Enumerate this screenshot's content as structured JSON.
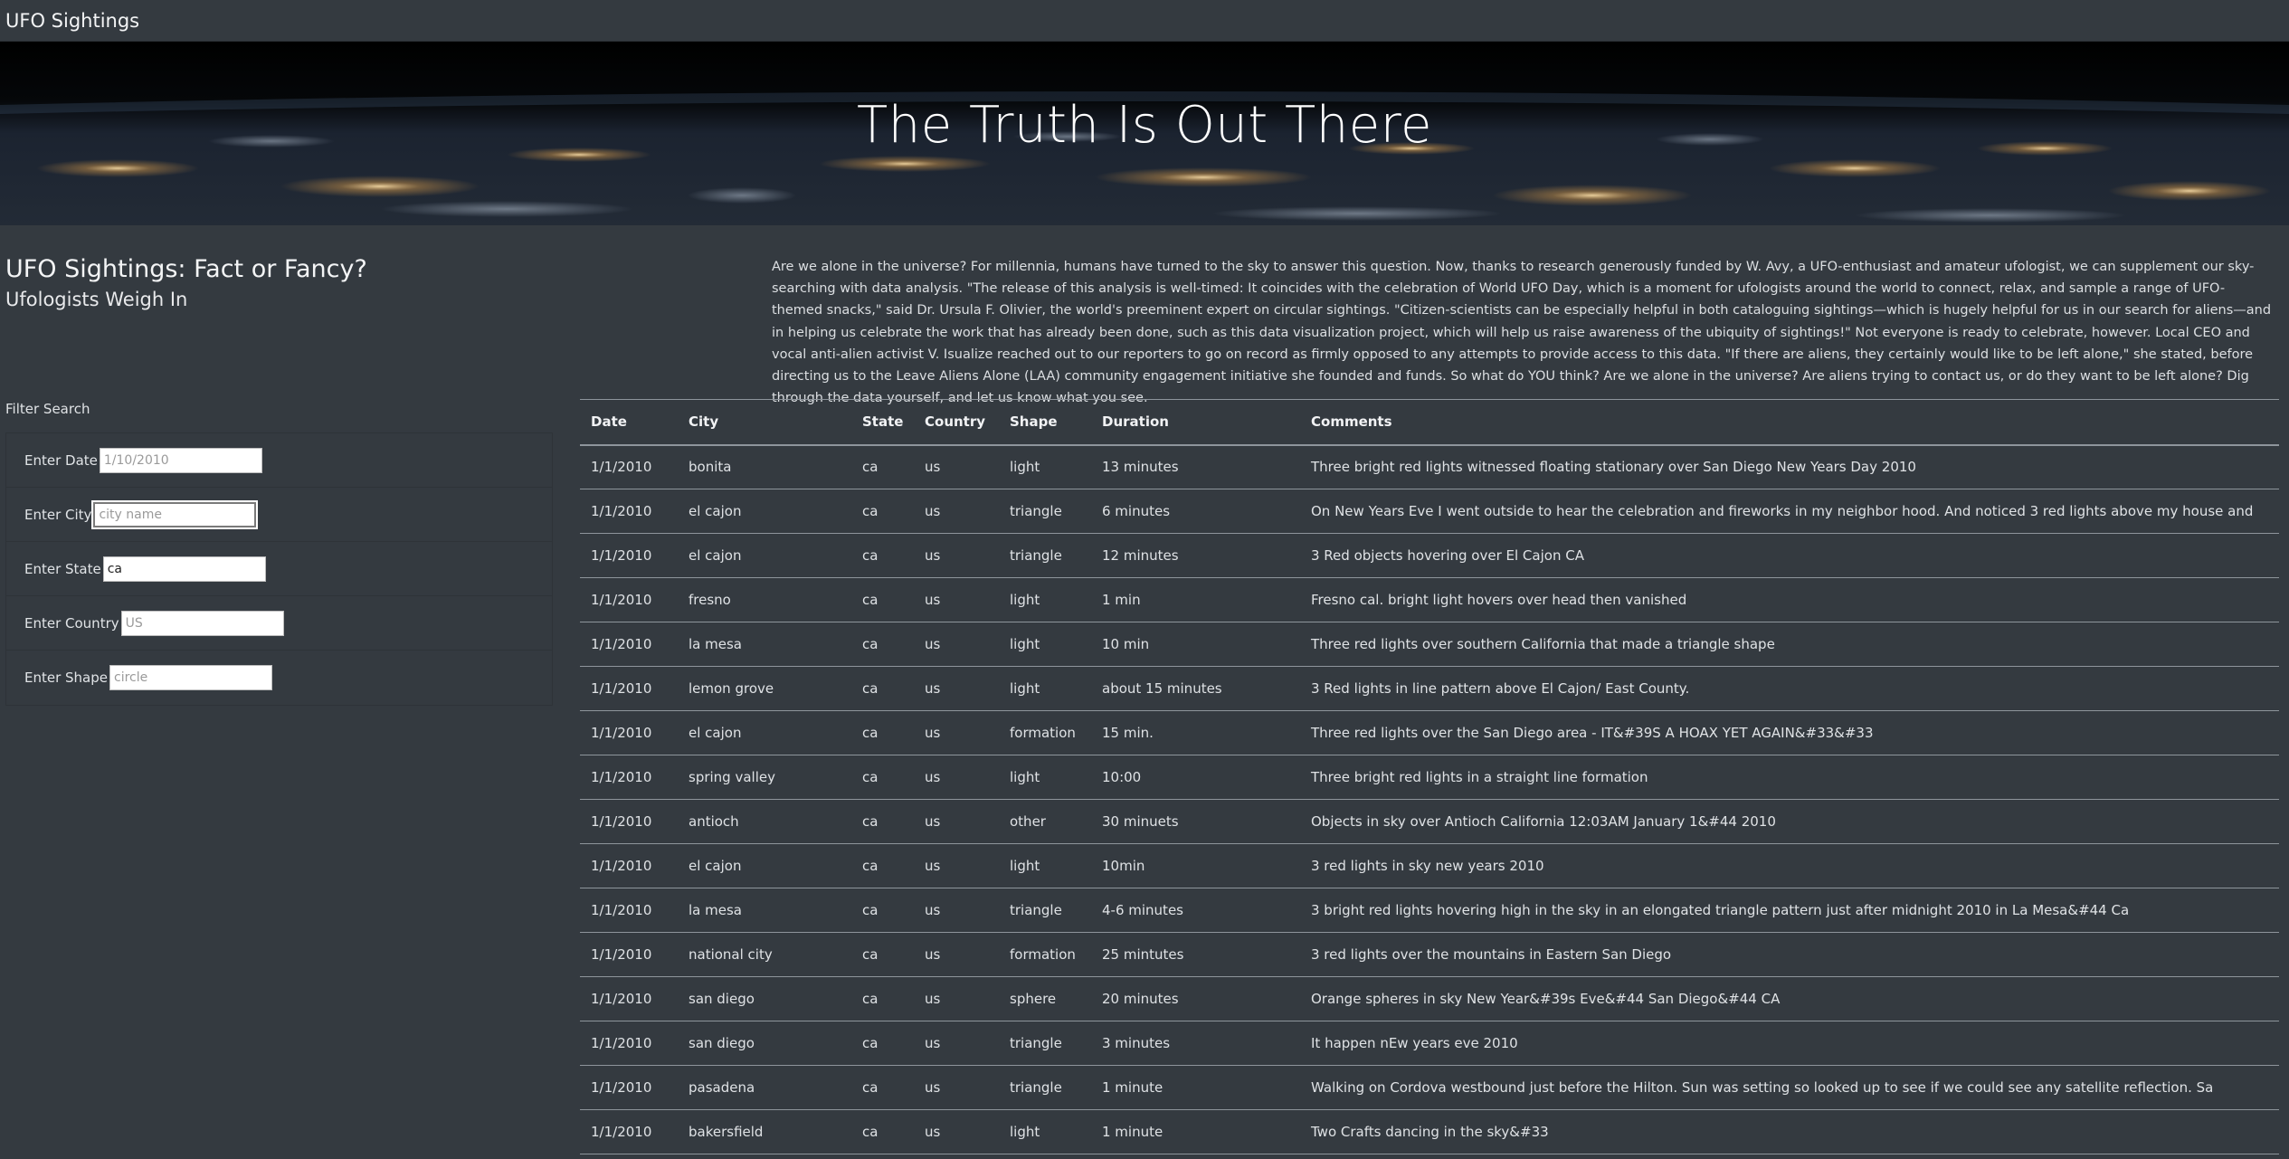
{
  "navbar": {
    "brand": "UFO Sightings"
  },
  "hero": {
    "heading": "The Truth Is Out There"
  },
  "title": {
    "main": "UFO Sightings: Fact or Fancy?",
    "sub": "Ufologists Weigh In"
  },
  "intro": "Are we alone in the universe? For millennia, humans have turned to the sky to answer this question. Now, thanks to research generously funded by W. Avy, a UFO-enthusiast and amateur ufologist, we can supplement our sky-searching with data analysis. \"The release of this analysis is well-timed: It coincides with the celebration of World UFO Day, which is a moment for ufologists around the world to connect, relax, and sample a range of UFO-themed snacks,\" said Dr. Ursula F. Olivier, the world's preeminent expert on circular sightings. \"Citizen-scientists can be especially helpful in both cataloguing sightings—which is hugely helpful for us in our search for aliens—and in helping us celebrate the work that has already been done, such as this data visualization project, which will help us raise awareness of the ubiquity of sightings!\" Not everyone is ready to celebrate, however. Local CEO and vocal anti-alien activist V. Isualize reached out to our reporters to go on record as firmly opposed to any attempts to provide access to this data. \"If there are aliens, they certainly would like to be left alone,\" she stated, before directing us to the Leave Aliens Alone (LAA) community engagement initiative she founded and funds. So what do YOU think? Are we alone in the universe? Are aliens trying to contact us, or do they want to be left alone? Dig through the data yourself, and let us know what you see.",
  "filters": {
    "heading": "Filter Search",
    "date": {
      "label": "Enter Date",
      "placeholder": "1/10/2010",
      "value": ""
    },
    "city": {
      "label": "Enter City",
      "placeholder": "city name",
      "value": ""
    },
    "state": {
      "label": "Enter State",
      "placeholder": "",
      "value": "ca"
    },
    "country": {
      "label": "Enter Country",
      "placeholder": "US",
      "value": ""
    },
    "shape": {
      "label": "Enter Shape",
      "placeholder": "circle",
      "value": ""
    }
  },
  "table": {
    "headers": [
      "Date",
      "City",
      "State",
      "Country",
      "Shape",
      "Duration",
      "Comments"
    ],
    "rows": [
      [
        "1/1/2010",
        "bonita",
        "ca",
        "us",
        "light",
        "13 minutes",
        "Three bright red lights witnessed floating stationary over San Diego New Years Day 2010"
      ],
      [
        "1/1/2010",
        "el cajon",
        "ca",
        "us",
        "triangle",
        "6 minutes",
        "On New Years Eve I went outside to hear the celebration and fireworks in my neighbor hood. And noticed 3 red lights above my house and"
      ],
      [
        "1/1/2010",
        "el cajon",
        "ca",
        "us",
        "triangle",
        "12 minutes",
        "3 Red objects hovering over El Cajon CA"
      ],
      [
        "1/1/2010",
        "fresno",
        "ca",
        "us",
        "light",
        "1 min",
        "Fresno cal. bright light hovers over head then vanished"
      ],
      [
        "1/1/2010",
        "la mesa",
        "ca",
        "us",
        "light",
        "10 min",
        "Three red lights over southern California that made a triangle shape"
      ],
      [
        "1/1/2010",
        "lemon grove",
        "ca",
        "us",
        "light",
        "about 15 minutes",
        "3 Red lights in line pattern above El Cajon/ East County."
      ],
      [
        "1/1/2010",
        "el cajon",
        "ca",
        "us",
        "formation",
        "15 min.",
        "Three red lights over the San Diego area - IT&#39S A HOAX YET AGAIN&#33&#33"
      ],
      [
        "1/1/2010",
        "spring valley",
        "ca",
        "us",
        "light",
        "10:00",
        "Three bright red lights in a straight line formation"
      ],
      [
        "1/1/2010",
        "antioch",
        "ca",
        "us",
        "other",
        "30 minuets",
        "Objects in sky over Antioch California 12:03AM January 1&#44 2010"
      ],
      [
        "1/1/2010",
        "el cajon",
        "ca",
        "us",
        "light",
        "10min",
        "3 red lights in sky new years 2010"
      ],
      [
        "1/1/2010",
        "la mesa",
        "ca",
        "us",
        "triangle",
        "4-6 minutes",
        "3 bright red lights hovering high in the sky in an elongated triangle pattern just after midnight 2010 in La Mesa&#44 Ca"
      ],
      [
        "1/1/2010",
        "national city",
        "ca",
        "us",
        "formation",
        "25 mintutes",
        "3 red lights over the mountains in Eastern San Diego"
      ],
      [
        "1/1/2010",
        "san diego",
        "ca",
        "us",
        "sphere",
        "20 minutes",
        "Orange spheres in sky New Year&#39s Eve&#44 San Diego&#44 CA"
      ],
      [
        "1/1/2010",
        "san diego",
        "ca",
        "us",
        "triangle",
        "3 minutes",
        "It happen nEw years eve 2010"
      ],
      [
        "1/1/2010",
        "pasadena",
        "ca",
        "us",
        "triangle",
        "1 minute",
        "Walking on Cordova westbound just before the Hilton. Sun was setting so looked up to see if we could see any satellite reflection. Sa"
      ],
      [
        "1/1/2010",
        "bakersfield",
        "ca",
        "us",
        "light",
        "1 minute",
        "Two Crafts dancing in the sky&#33"
      ]
    ]
  }
}
